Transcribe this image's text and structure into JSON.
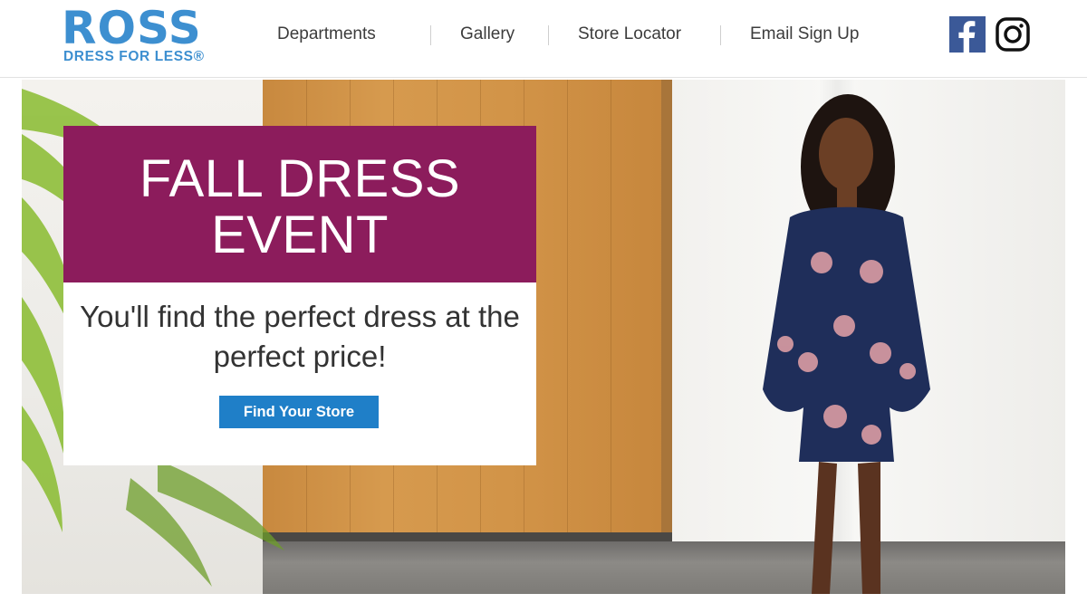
{
  "brand": {
    "name": "ROSS",
    "tagline": "DRESS FOR LESS®"
  },
  "nav": {
    "items": [
      {
        "label": "Departments"
      },
      {
        "label": "Gallery"
      },
      {
        "label": "Store Locator"
      },
      {
        "label": "Email Sign Up"
      }
    ]
  },
  "social": {
    "facebook_icon": "facebook-icon",
    "instagram_icon": "instagram-icon"
  },
  "hero": {
    "title": "FALL DRESS EVENT",
    "subtitle": "You'll find the perfect dress at the perfect price!",
    "cta_label": "Find Your Store"
  },
  "colors": {
    "brand_blue": "#3d8fd0",
    "promo_magenta": "#8c1c5c",
    "cta_blue": "#1f7fc8",
    "facebook_blue": "#3b5998"
  }
}
